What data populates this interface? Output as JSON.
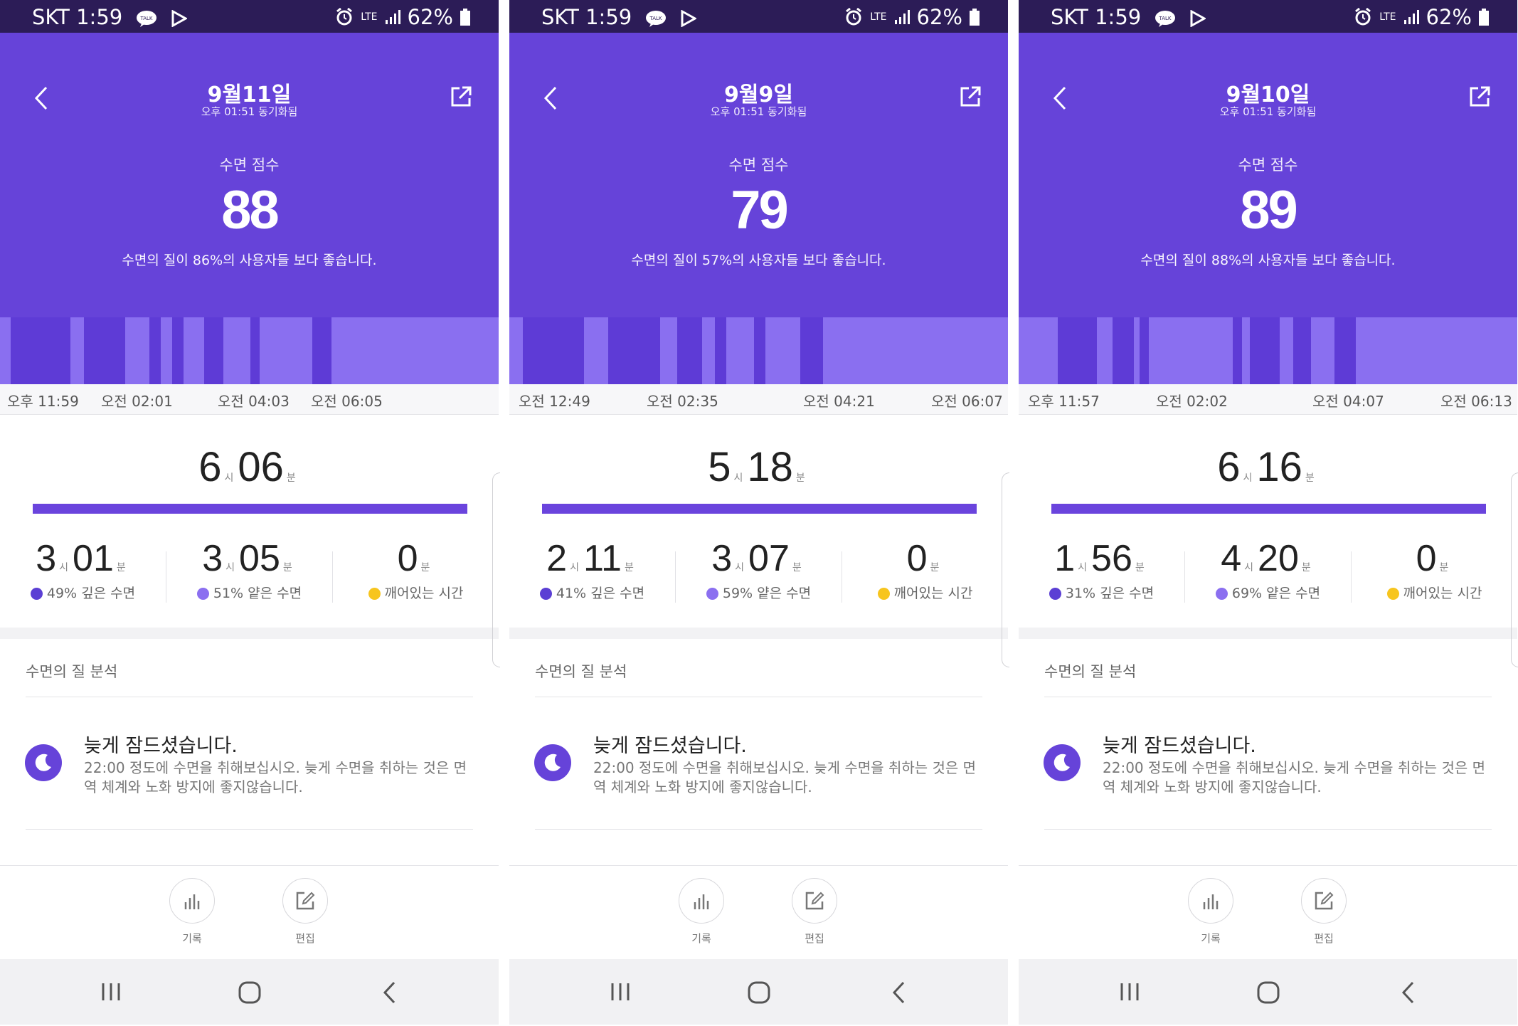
{
  "panels": [
    {
      "status": {
        "carrier": "SKT",
        "time": "1:59",
        "battery": "62%",
        "network": "LTE"
      },
      "date": "9월11일",
      "sync": "오후 01:51 동기화됨",
      "score_label": "수면 점수",
      "score": "88",
      "score_desc": "수면의 질이 86%의 사용자들 보다 좋습니다.",
      "timeline": [
        "오후 11:59",
        "오전 02:01",
        "오전 04:03",
        "오전 06:05"
      ],
      "total": {
        "hours": "6",
        "minutes": "06"
      },
      "stats": [
        {
          "hours": "3",
          "minutes": "01",
          "legend": "49% 깊은 수면",
          "color": "#5b3fd4"
        },
        {
          "hours": "3",
          "minutes": "05",
          "legend": "51% 얕은 수면",
          "color": "#8b6ff0"
        },
        {
          "hours": "",
          "minutes": "0",
          "legend": "깨어있는 시간",
          "color": "#f7c51e"
        }
      ],
      "analysis_title": "수면의 질 분석",
      "advice_title": "늦게 잠드셨습니다.",
      "advice_body": "22:00 정도에 수면을 취해보십시오. 늦게 수면을 취하는 것은 면역 체계와 노화 방지에 좋지않습니다.",
      "actions": {
        "record": "기록",
        "edit": "편집"
      },
      "units": {
        "hour": "시",
        "minute": "분"
      }
    },
    {
      "status": {
        "carrier": "SKT",
        "time": "1:59",
        "battery": "62%",
        "network": "LTE"
      },
      "date": "9월9일",
      "sync": "오후 01:51 동기화됨",
      "score_label": "수면 점수",
      "score": "79",
      "score_desc": "수면의 질이 57%의 사용자들 보다 좋습니다.",
      "timeline": [
        "오전 12:49",
        "오전 02:35",
        "오전 04:21",
        "오전 06:07"
      ],
      "total": {
        "hours": "5",
        "minutes": "18"
      },
      "stats": [
        {
          "hours": "2",
          "minutes": "11",
          "legend": "41% 깊은 수면",
          "color": "#5b3fd4"
        },
        {
          "hours": "3",
          "minutes": "07",
          "legend": "59% 얕은 수면",
          "color": "#8b6ff0"
        },
        {
          "hours": "",
          "minutes": "0",
          "legend": "깨어있는 시간",
          "color": "#f7c51e"
        }
      ],
      "analysis_title": "수면의 질 분석",
      "advice_title": "늦게 잠드셨습니다.",
      "advice_body": "22:00 정도에 수면을 취해보십시오. 늦게 수면을 취하는 것은 면역 체계와 노화 방지에 좋지않습니다.",
      "actions": {
        "record": "기록",
        "edit": "편집"
      },
      "units": {
        "hour": "시",
        "minute": "분"
      }
    },
    {
      "status": {
        "carrier": "SKT",
        "time": "1:59",
        "battery": "62%",
        "network": "LTE"
      },
      "date": "9월10일",
      "sync": "오후 01:51 동기화됨",
      "score_label": "수면 점수",
      "score": "89",
      "score_desc": "수면의 질이 88%의 사용자들 보다 좋습니다.",
      "timeline": [
        "오후 11:57",
        "오전 02:02",
        "오전 04:07",
        "오전 06:13"
      ],
      "total": {
        "hours": "6",
        "minutes": "16"
      },
      "stats": [
        {
          "hours": "1",
          "minutes": "56",
          "legend": "31% 깊은 수면",
          "color": "#5b3fd4"
        },
        {
          "hours": "4",
          "minutes": "20",
          "legend": "69% 얕은 수면",
          "color": "#8b6ff0"
        },
        {
          "hours": "",
          "minutes": "0",
          "legend": "깨어있는 시간",
          "color": "#f7c51e"
        }
      ],
      "analysis_title": "수면의 질 분석",
      "advice_title": "늦게 잠드셨습니다.",
      "advice_body": "22:00 정도에 수면을 취해보십시오. 늦게 수면을 취하는 것은 면역 체계와 노화 방지에 좋지않습니다.",
      "actions": {
        "record": "기록",
        "edit": "편집"
      },
      "units": {
        "hour": "시",
        "minute": "분"
      }
    }
  ],
  "colors": {
    "header": "#6643d9",
    "deep": "#5e3bd6",
    "light": "#8a6ff0",
    "awake": "#f7c51e"
  },
  "icons": [
    "back-icon",
    "share-icon",
    "moon-icon",
    "bar-chart-icon",
    "edit-icon",
    "recent-apps-icon",
    "home-icon",
    "nav-back-icon"
  ]
}
